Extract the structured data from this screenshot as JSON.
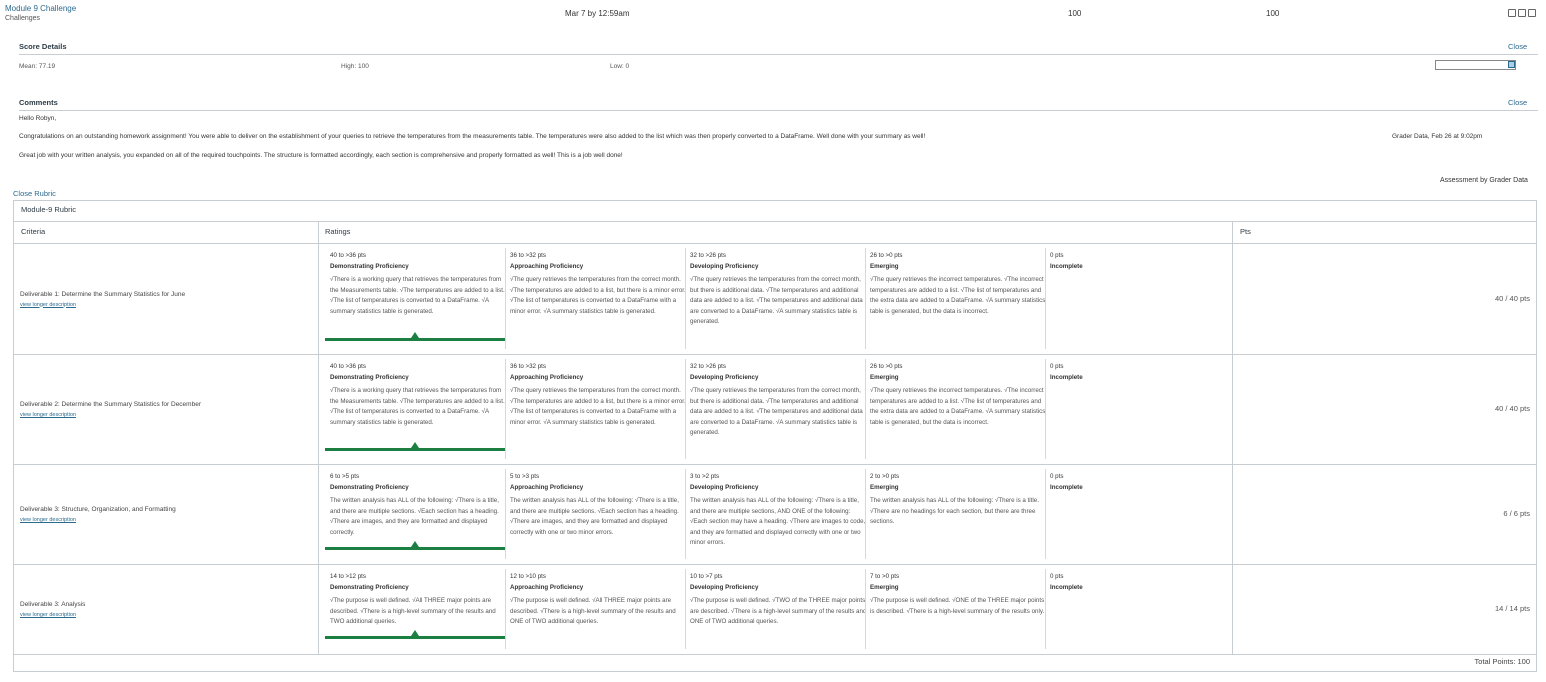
{
  "assignment": {
    "name": "Module 9 Challenge",
    "context": "Challenges",
    "due": "Mar 7 by 12:59am",
    "score": "100",
    "out_of": "100"
  },
  "score_details": {
    "title": "Score Details",
    "close": "Close",
    "mean": "Mean: 77.19",
    "high": "High: 100",
    "low": "Low: 0"
  },
  "comments": {
    "title": "Comments",
    "close": "Close",
    "greeting": "Hello Robyn,",
    "para1": "Congratulations on an outstanding homework assignment! You were able to deliver on the establishment of your queries to retrieve the temperatures from the measurements table. The temperatures were also added to the list which was then properly converted to a DataFrame. Well done with your summary as well!",
    "para2": "Great job with your written analysis, you expanded on all of the required touchpoints. The structure is formatted accordingly, each section is comprehensive and properly formatted as well! This is a job well done!",
    "author_date": "Grader Data, Feb 26 at 9:02pm"
  },
  "rubric": {
    "close_link": "Close Rubric",
    "assessment_by": "Assessment by Grader Data",
    "title": "Module-9 Rubric",
    "col_criteria": "Criteria",
    "col_ratings": "Ratings",
    "col_pts": "Pts",
    "view_longer": "view longer description",
    "total": "Total Points: 100",
    "criteria": [
      {
        "name": "Deliverable 1: Determine the Summary Statistics for June",
        "points": "40 / 40 pts",
        "ratings": [
          {
            "pts": "40 to >36 pts",
            "title": "Demonstrating Proficiency",
            "desc": "√There is a working query that retrieves the temperatures from the Measurements table. √The temperatures are added to a list. √The list of temperatures is converted to a DataFrame. √A summary statistics table is generated."
          },
          {
            "pts": "36 to >32 pts",
            "title": "Approaching Proficiency",
            "desc": "√The query retrieves the temperatures from the correct month. √The temperatures are added to a list, but there is a minor error. √The list of temperatures is converted to a DataFrame with a minor error. √A summary statistics table is generated."
          },
          {
            "pts": "32 to >26 pts",
            "title": "Developing Proficiency",
            "desc": "√The query retrieves the temperatures from the correct month, but there is additional data. √The temperatures and additional data are added to a list. √The temperatures and additional data are converted to a DataFrame. √A summary statistics table is generated."
          },
          {
            "pts": "26 to >0 pts",
            "title": "Emerging",
            "desc": "√The query retrieves the incorrect temperatures. √The incorrect temperatures are added to a list. √The list of temperatures and the extra data are added to a DataFrame. √A summary statistics table is generated, but the data is incorrect."
          },
          {
            "pts": "0 pts",
            "title": "Incomplete",
            "desc": ""
          }
        ]
      },
      {
        "name": "Deliverable 2: Determine the Summary Statistics for December",
        "points": "40 / 40 pts",
        "ratings": [
          {
            "pts": "40 to >36 pts",
            "title": "Demonstrating Proficiency",
            "desc": "√There is a working query that retrieves the temperatures from the Measurements table. √The temperatures are added to a list. √The list of temperatures is converted to a DataFrame. √A summary statistics table is generated."
          },
          {
            "pts": "36 to >32 pts",
            "title": "Approaching Proficiency",
            "desc": "√The query retrieves the temperatures from the correct month. √The temperatures are added to a list, but there is a minor error. √The list of temperatures is converted to a DataFrame with a minor error. √A summary statistics table is generated."
          },
          {
            "pts": "32 to >26 pts",
            "title": "Developing Proficiency",
            "desc": "√The query retrieves the temperatures from the correct month, but there is additional data. √The temperatures and additional data are added to a list. √The temperatures and additional data are converted to a DataFrame. √A summary statistics table is generated."
          },
          {
            "pts": "26 to >0 pts",
            "title": "Emerging",
            "desc": "√The query retrieves the incorrect temperatures. √The incorrect temperatures are added to a list. √The list of temperatures and the extra data are added to a DataFrame. √A summary statistics table is generated, but the data is incorrect."
          },
          {
            "pts": "0 pts",
            "title": "Incomplete",
            "desc": ""
          }
        ]
      },
      {
        "name": "Deliverable 3: Structure, Organization, and Formatting",
        "points": "6 / 6 pts",
        "ratings": [
          {
            "pts": "6 to >5 pts",
            "title": "Demonstrating Proficiency",
            "desc": "The written analysis has ALL of the following: √There is a title, and there are multiple sections. √Each section has a heading. √There are images, and they are formatted and displayed correctly."
          },
          {
            "pts": "5 to >3 pts",
            "title": "Approaching Proficiency",
            "desc": "The written analysis has ALL of the following: √There is a title, and there are multiple sections. √Each section has a heading. √There are images, and they are formatted and displayed correctly with one or two minor errors."
          },
          {
            "pts": "3 to >2 pts",
            "title": "Developing Proficiency",
            "desc": "The written analysis has ALL of the following: √There is a title, and there are multiple sections, AND ONE of the following: √Each section may have a heading. √There are images to code, and they are formatted and displayed correctly with one or two minor errors."
          },
          {
            "pts": "2 to >0 pts",
            "title": "Emerging",
            "desc": "The written analysis has ALL of the following: √There is a title. √There are no headings for each section, but there are three sections."
          },
          {
            "pts": "0 pts",
            "title": "Incomplete",
            "desc": ""
          }
        ]
      },
      {
        "name": "Deliverable 3: Analysis",
        "points": "14 / 14 pts",
        "ratings": [
          {
            "pts": "14 to >12 pts",
            "title": "Demonstrating Proficiency",
            "desc": "√The purpose is well defined. √All THREE major points are described. √There is a high-level summary of the results and TWO additional queries."
          },
          {
            "pts": "12 to >10 pts",
            "title": "Approaching Proficiency",
            "desc": "√The purpose is well defined. √All THREE major points are described. √There is a high-level summary of the results and ONE of TWO additional queries."
          },
          {
            "pts": "10 to >7 pts",
            "title": "Developing Proficiency",
            "desc": "√The purpose is well defined. √TWO of the THREE major points are described. √There is a high-level summary of the results and ONE of TWO additional queries."
          },
          {
            "pts": "7 to >0 pts",
            "title": "Emerging",
            "desc": "√The purpose is well defined. √ONE of the THREE major points is described. √There is a high-level summary of the results only."
          },
          {
            "pts": "0 pts",
            "title": "Incomplete",
            "desc": ""
          }
        ]
      }
    ]
  }
}
